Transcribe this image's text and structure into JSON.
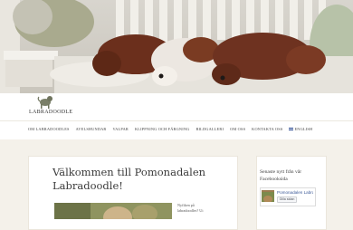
{
  "site": {
    "logo_text": "LABRADOODLE"
  },
  "nav": {
    "items": [
      "OM LABRADOODLES",
      "AVELSHUNDAR",
      "VALPAR",
      "KLIPPNING OCH FÄRGNING",
      "BILDGALLERI",
      "OM OSS",
      "KONTAKTA OSS"
    ],
    "language_label": "ENGLISH"
  },
  "main": {
    "title": "Välkommen till Pomonadalen Labradoodle!",
    "intro_text": "Nyfiken på labradoodles? Ui"
  },
  "sidebar": {
    "title": "Senaste nytt från vår Facebooksida",
    "fb_page_name": "Pomonadalen Labradoodle",
    "fb_like_label": "Gilla sidan"
  },
  "colors": {
    "background": "#f4f1ea",
    "nav_text": "#444444",
    "facebook_link": "#3b5998"
  },
  "icons": [
    "labradoodle-logo-icon",
    "uk-flag-icon"
  ]
}
